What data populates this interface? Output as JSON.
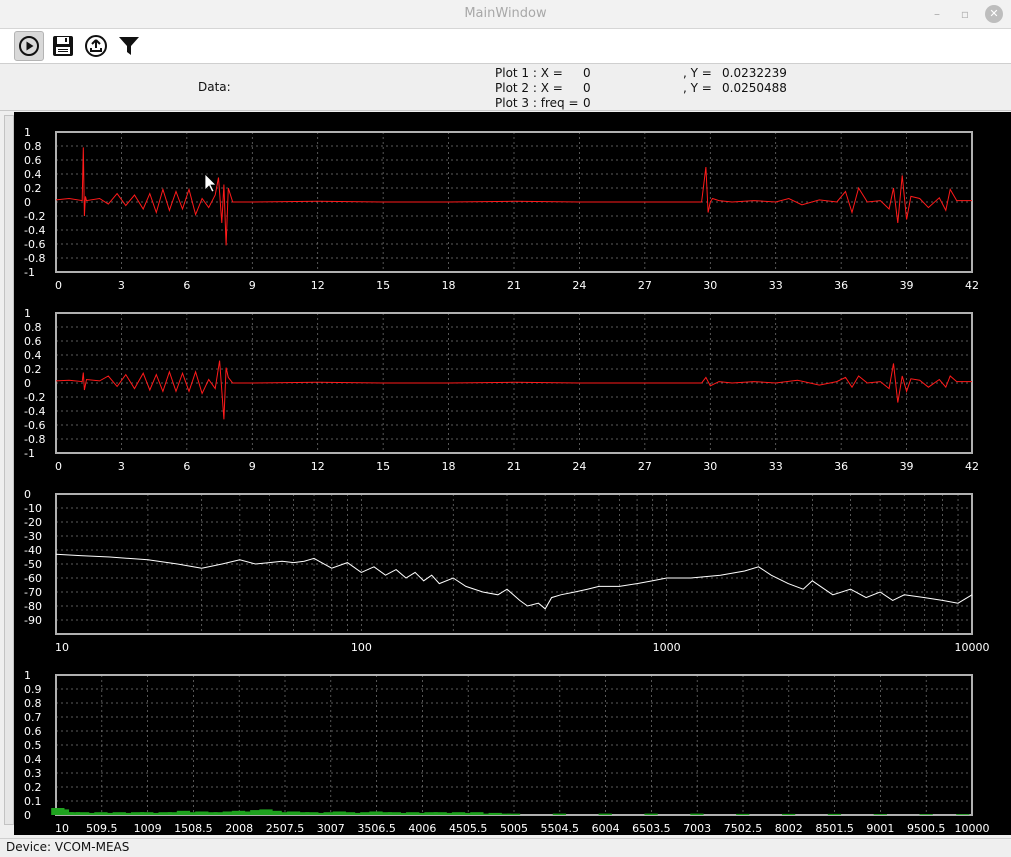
{
  "window": {
    "title": "MainWindow",
    "minimize": "–",
    "maximize": "▫",
    "close": "✕"
  },
  "toolbar": {
    "buttons": [
      {
        "name": "play-icon",
        "active": true
      },
      {
        "name": "save-icon",
        "active": false
      },
      {
        "name": "upload-icon",
        "active": false
      },
      {
        "name": "filter-icon",
        "active": false
      }
    ]
  },
  "info": {
    "data_label": "Data:",
    "plot1_x": "Plot 1 : X =",
    "plot1_x_val": "0",
    "plot1_y": ", Y =",
    "plot1_y_val": "0.0232239",
    "plot2_x": "Plot 2 : X =",
    "plot2_x_val": "0",
    "plot2_y": ", Y =",
    "plot2_y_val": "0.0250488",
    "plot3": "Plot 3 : freq =",
    "plot3_val": "0"
  },
  "status": {
    "device": "Device: VCOM-MEAS"
  },
  "colors": {
    "signal": "#ff1a1a",
    "spectrum": "#ffffff",
    "histogram": "#1fa31f",
    "grid": "#7a7a7a",
    "frame": "#b0b0b0"
  },
  "chart_data": [
    {
      "type": "line",
      "xlim": [
        0,
        42
      ],
      "ylim": [
        -1,
        1
      ],
      "xticks": [
        "0",
        "3",
        "6",
        "9",
        "12",
        "15",
        "18",
        "21",
        "24",
        "27",
        "30",
        "33",
        "36",
        "39",
        "42"
      ],
      "yticks": [
        "1",
        "0.8",
        "0.6",
        "0.4",
        "0.2",
        "0",
        "-0.2",
        "-0.4",
        "-0.6",
        "-0.8",
        "-1"
      ],
      "series": [
        {
          "color": "#ff1a1a",
          "x": [
            0,
            0.6,
            1.2,
            1.25,
            1.3,
            1.35,
            1.4,
            2,
            2.4,
            2.8,
            3.2,
            3.6,
            4,
            4.3,
            4.6,
            4.9,
            5.2,
            5.5,
            5.8,
            6.1,
            6.4,
            6.7,
            7,
            7.3,
            7.45,
            7.6,
            7.7,
            7.8,
            7.9,
            8.1,
            9,
            12,
            15,
            18,
            21,
            24,
            27,
            29.6,
            29.8,
            29.9,
            30,
            30.1,
            30.4,
            31,
            32,
            33,
            33.6,
            34.2,
            35,
            35.8,
            36.2,
            36.5,
            36.8,
            37.2,
            37.8,
            38.2,
            38.4,
            38.6,
            38.8,
            39,
            39.2,
            39.6,
            40,
            40.5,
            40.8,
            41,
            41.3,
            42
          ],
          "y": [
            0.03,
            0.05,
            0.02,
            0.78,
            -0.2,
            0.08,
            0.02,
            0.05,
            -0.03,
            0.12,
            -0.05,
            0.1,
            -0.1,
            0.12,
            -0.15,
            0.18,
            -0.12,
            0.15,
            -0.1,
            0.18,
            -0.18,
            0.05,
            -0.08,
            0.1,
            0.35,
            -0.3,
            0.25,
            -0.62,
            0.2,
            0.0,
            0.0,
            0.01,
            0.0,
            0.0,
            0.01,
            0.0,
            0.0,
            0.0,
            0.5,
            -0.15,
            0.0,
            0.05,
            0.02,
            0.0,
            0.02,
            0.0,
            0.05,
            -0.04,
            0.03,
            0.0,
            0.15,
            -0.15,
            0.2,
            0.0,
            0.02,
            -0.1,
            0.2,
            -0.3,
            0.38,
            -0.25,
            0.08,
            0.05,
            -0.08,
            0.06,
            -0.12,
            0.18,
            0.02,
            0.02
          ]
        }
      ]
    },
    {
      "type": "line",
      "xlim": [
        0,
        42
      ],
      "ylim": [
        -1,
        1
      ],
      "xticks": [
        "0",
        "3",
        "6",
        "9",
        "12",
        "15",
        "18",
        "21",
        "24",
        "27",
        "30",
        "33",
        "36",
        "39",
        "42"
      ],
      "yticks": [
        "1",
        "0.8",
        "0.6",
        "0.4",
        "0.2",
        "0",
        "-0.2",
        "-0.4",
        "-0.6",
        "-0.8",
        "-1"
      ],
      "series": [
        {
          "color": "#ff1a1a",
          "x": [
            0,
            0.6,
            1.2,
            1.25,
            1.3,
            1.4,
            2,
            2.4,
            2.8,
            3.2,
            3.6,
            4,
            4.3,
            4.6,
            4.9,
            5.2,
            5.5,
            5.8,
            6.1,
            6.4,
            6.7,
            7,
            7.3,
            7.5,
            7.7,
            7.8,
            7.9,
            8.1,
            9,
            12,
            15,
            18,
            21,
            24,
            27,
            29.6,
            29.8,
            30,
            30.4,
            31,
            32,
            33,
            34,
            35,
            35.8,
            36.2,
            36.5,
            36.8,
            37.2,
            37.8,
            38.2,
            38.4,
            38.6,
            38.8,
            39,
            39.2,
            39.6,
            40,
            40.5,
            40.8,
            41,
            41.3,
            42
          ],
          "y": [
            0.03,
            0.04,
            0.02,
            0.15,
            -0.1,
            0.05,
            0.03,
            0.1,
            -0.05,
            0.12,
            -0.08,
            0.14,
            -0.1,
            0.12,
            -0.12,
            0.16,
            -0.12,
            0.14,
            -0.12,
            0.16,
            -0.15,
            0.05,
            -0.08,
            0.32,
            -0.52,
            0.22,
            0.08,
            0.0,
            0.0,
            0.01,
            0.0,
            0.0,
            0.01,
            0.0,
            0.0,
            0.0,
            0.08,
            -0.04,
            0.02,
            0.0,
            0.02,
            0.0,
            0.04,
            -0.03,
            0.02,
            0.08,
            -0.06,
            0.1,
            0.0,
            0.02,
            -0.08,
            0.28,
            -0.28,
            0.1,
            -0.12,
            0.06,
            0.04,
            -0.06,
            0.05,
            -0.06,
            0.1,
            0.02,
            0.02
          ]
        }
      ]
    },
    {
      "type": "line",
      "xscale": "log",
      "xlim": [
        10,
        10000
      ],
      "ylim": [
        -100,
        0
      ],
      "xticks": [
        "10",
        "100",
        "1000",
        "10000"
      ],
      "yticks": [
        "0",
        "-10",
        "-20",
        "-30",
        "-40",
        "-50",
        "-60",
        "-70",
        "-80",
        "-90"
      ],
      "series": [
        {
          "color": "#ffffff",
          "x": [
            10,
            12,
            15,
            20,
            25,
            30,
            35,
            40,
            45,
            50,
            55,
            60,
            65,
            70,
            80,
            90,
            100,
            110,
            120,
            130,
            140,
            150,
            160,
            170,
            180,
            200,
            220,
            250,
            280,
            300,
            330,
            350,
            380,
            400,
            420,
            450,
            500,
            550,
            600,
            700,
            800,
            900,
            1000,
            1200,
            1500,
            1800,
            2000,
            2200,
            2500,
            2800,
            3000,
            3500,
            4000,
            4500,
            5000,
            5500,
            6000,
            7000,
            8000,
            9000,
            10000
          ],
          "y": [
            -43,
            -44,
            -45,
            -47,
            -50,
            -53,
            -50,
            -47,
            -50,
            -49,
            -48,
            -49,
            -48,
            -46,
            -53,
            -49,
            -56,
            -52,
            -58,
            -54,
            -60,
            -56,
            -62,
            -58,
            -64,
            -60,
            -66,
            -70,
            -72,
            -68,
            -76,
            -80,
            -78,
            -82,
            -74,
            -72,
            -70,
            -68,
            -66,
            -66,
            -64,
            -62,
            -60,
            -60,
            -58,
            -55,
            -52,
            -58,
            -64,
            -68,
            -62,
            -72,
            -68,
            -74,
            -70,
            -76,
            -72,
            -74,
            -76,
            -78,
            -72
          ]
        }
      ]
    },
    {
      "type": "bar",
      "xlim": [
        10,
        10000
      ],
      "ylim": [
        0,
        1
      ],
      "xticks": [
        "10",
        "509.5",
        "1009",
        "1508.5",
        "2008",
        "2507.5",
        "3007",
        "3506.5",
        "4006",
        "4505.5",
        "5005",
        "5504.5",
        "6004",
        "6503.5",
        "7003",
        "7502.5",
        "8002",
        "8501.5",
        "9001",
        "9500.5",
        "10000"
      ],
      "yticks": [
        "1",
        "0.9",
        "0.8",
        "0.7",
        "0.6",
        "0.5",
        "0.4",
        "0.3",
        "0.2",
        "0.1",
        "0"
      ],
      "series": [
        {
          "color": "#1fa31f",
          "x": [
            30,
            80,
            130,
            200,
            300,
            400,
            500,
            600,
            700,
            800,
            900,
            1000,
            1100,
            1200,
            1300,
            1400,
            1500,
            1600,
            1700,
            1800,
            1900,
            2000,
            2100,
            2200,
            2300,
            2400,
            2500,
            2600,
            2700,
            2800,
            2900,
            3000,
            3100,
            3200,
            3300,
            3400,
            3500,
            3600,
            3700,
            3800,
            3900,
            4000,
            4100,
            4200,
            4300,
            4400,
            4500,
            4600,
            4700,
            4800,
            4900,
            5000,
            5500,
            6000,
            6500,
            7000,
            7500,
            8000,
            8500,
            9000,
            9500,
            9900
          ],
          "y": [
            0.05,
            0.04,
            0.02,
            0.02,
            0.02,
            0.015,
            0.02,
            0.015,
            0.02,
            0.015,
            0.02,
            0.02,
            0.015,
            0.02,
            0.02,
            0.03,
            0.02,
            0.025,
            0.02,
            0.02,
            0.025,
            0.03,
            0.025,
            0.035,
            0.04,
            0.03,
            0.02,
            0.025,
            0.02,
            0.02,
            0.015,
            0.02,
            0.025,
            0.02,
            0.015,
            0.02,
            0.025,
            0.02,
            0.02,
            0.015,
            0.02,
            0.015,
            0.02,
            0.02,
            0.015,
            0.02,
            0.015,
            0.02,
            0.01,
            0.015,
            0.01,
            0.01,
            0.01,
            0.01,
            0.01,
            0.01,
            0.008,
            0.008,
            0.008,
            0.006,
            0.006,
            0.006
          ]
        }
      ]
    }
  ]
}
